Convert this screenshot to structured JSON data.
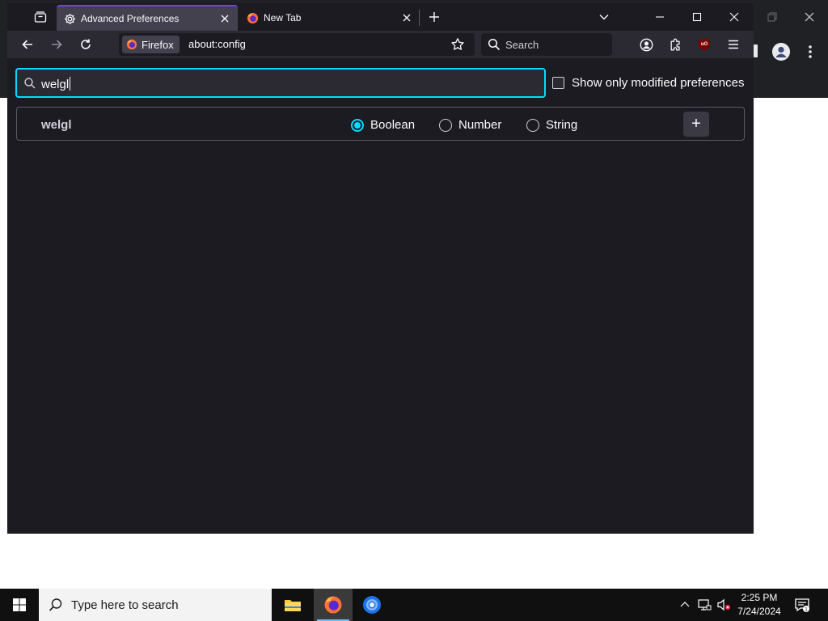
{
  "browser": {
    "tabs": [
      {
        "label": "Advanced Preferences",
        "active": true,
        "icon": "gear-icon"
      },
      {
        "label": "New Tab",
        "active": false,
        "icon": "firefox-icon"
      }
    ],
    "identity_label": "Firefox",
    "url": "about:config",
    "search_placeholder": "Search"
  },
  "config": {
    "search_value": "welgl",
    "show_modified_label": "Show only modified preferences",
    "new_pref": {
      "name": "welgl",
      "types": [
        {
          "label": "Boolean",
          "selected": true
        },
        {
          "label": "Number",
          "selected": false
        },
        {
          "label": "String",
          "selected": false
        }
      ],
      "add_label": "+"
    }
  },
  "taskbar": {
    "search_placeholder": "Type here to search",
    "time": "2:25 PM",
    "date": "7/24/2024"
  },
  "colors": {
    "accent": "#00ddff",
    "content_bg": "#1c1b22",
    "toolbar_bg": "#2b2a33"
  }
}
